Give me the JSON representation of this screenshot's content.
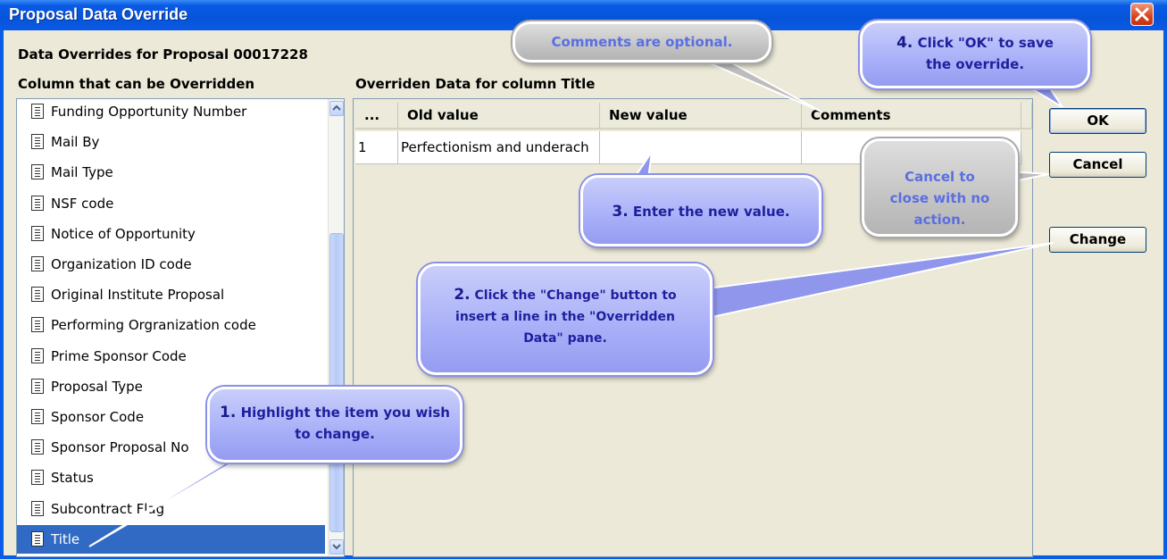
{
  "window": {
    "title": "Proposal Data Override"
  },
  "header": {
    "proposal_label": "Data Overrides for Proposal  00017228",
    "list_heading": "Column that can be Overridden",
    "grid_heading": "Overriden Data for column Title"
  },
  "column_list": {
    "items": [
      {
        "label": "Funding Opportunity Number"
      },
      {
        "label": "Mail By"
      },
      {
        "label": "Mail Type"
      },
      {
        "label": "NSF code"
      },
      {
        "label": "Notice of Opportunity"
      },
      {
        "label": "Organization ID code"
      },
      {
        "label": "Original Institute Proposal"
      },
      {
        "label": "Performing Orgranization code"
      },
      {
        "label": "Prime Sponsor Code"
      },
      {
        "label": "Proposal Type"
      },
      {
        "label": "Sponsor Code"
      },
      {
        "label": "Sponsor Proposal No"
      },
      {
        "label": "Status"
      },
      {
        "label": "Subcontract Flag"
      },
      {
        "label": "Title"
      }
    ],
    "selected": "Title"
  },
  "grid": {
    "columns": [
      "...",
      "Old value",
      "New value",
      "Comments"
    ],
    "rows": [
      {
        "index": "1",
        "old_value": "Perfectionism and underach",
        "new_value": "",
        "comments": ""
      }
    ]
  },
  "buttons": {
    "ok": "OK",
    "cancel": "Cancel",
    "change": "Change"
  },
  "callouts": {
    "step1_num": "1.",
    "step1_text": "Highlight the item you wish to change.",
    "step2_num": "2.",
    "step2_text": "Click the \"Change\" button to insert a line in the \"Overridden Data\" pane.",
    "step3_num": "3.",
    "step3_text": "Enter the new value.",
    "step4_num": "4.",
    "step4_text": "Click \"OK\" to save the override.",
    "comments_note": "Comments are optional.",
    "cancel_note": "Cancel to close with no action."
  },
  "colors": {
    "titlebar": "#0a5ae6",
    "selection": "#316ac5",
    "callout_blue": "#a8aff8",
    "callout_gray": "#c4c4c4"
  }
}
